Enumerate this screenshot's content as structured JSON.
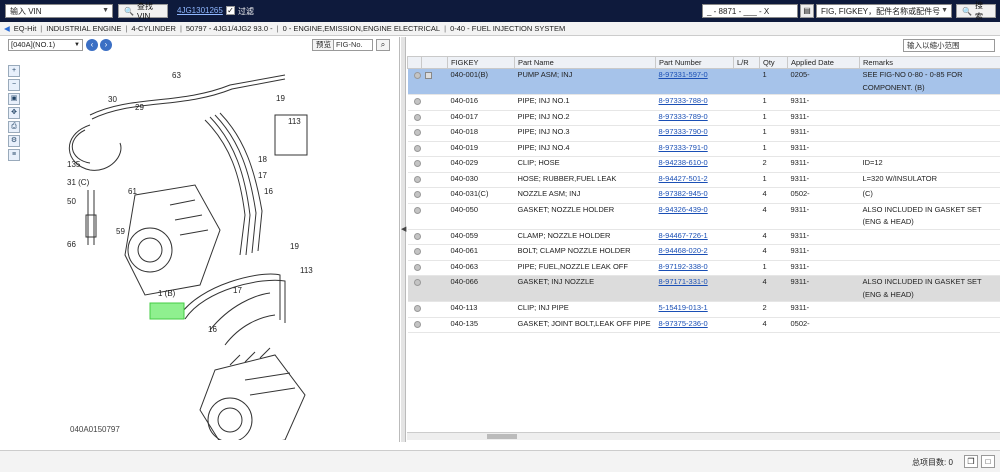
{
  "topbar": {
    "vin_select": "输入 VIN",
    "search_vin_button": "查找 VIN",
    "vin_link": "4JG1301265",
    "filter_label": "过滤",
    "code_field": "_ - 8871 - ___ - X",
    "fig_select": "FIG, FIGKEY，配件名称或配件号",
    "search_button": "搜索"
  },
  "breadcrumb": [
    "EQ-Hit",
    "INDUSTRIAL ENGINE",
    "4-CYLINDER",
    "50797 - 4JG1/4JG2 93.0 -",
    "0 - ENGINE,EMISSION,ENGINE ELECTRICAL",
    "0-40 - FUEL INJECTION SYSTEM"
  ],
  "left_toolbar": {
    "figure_select": "[040A](NO.1)",
    "preview_button": "预览",
    "fig_no_placeholder": "FIG-No."
  },
  "diagram": {
    "code": "040A0150797",
    "callouts": [
      "63",
      "30",
      "29",
      "19",
      "113",
      "18",
      "17",
      "16",
      "135",
      "31 (C)",
      "61",
      "50",
      "59",
      "66",
      "19",
      "113",
      "17",
      "16",
      "1 (B)"
    ]
  },
  "right_top": {
    "range_placeholder": "输入以缩小范围"
  },
  "table": {
    "headers": [
      "",
      "",
      "FIGKEY",
      "Part Name",
      "Part Number",
      "L/R",
      "Qty",
      "Applied Date",
      "Remarks"
    ],
    "rows": [
      {
        "figkey": "040-001(B)",
        "name": "PUMP ASM; INJ",
        "number": "8-97331-597-0",
        "lr": "",
        "qty": "1",
        "date": "0205-",
        "remarks": "SEE FIG-NO 0-80 - 0-85 FOR COMPONENT. (B)",
        "style": "selected",
        "img": true
      },
      {
        "figkey": "040-016",
        "name": "PIPE; INJ NO.1",
        "number": "8-97333-788-0",
        "lr": "",
        "qty": "1",
        "date": "9311-",
        "remarks": "",
        "style": "",
        "img": false
      },
      {
        "figkey": "040-017",
        "name": "PIPE; INJ NO.2",
        "number": "8-97333-789-0",
        "lr": "",
        "qty": "1",
        "date": "9311-",
        "remarks": "",
        "style": "",
        "img": false
      },
      {
        "figkey": "040-018",
        "name": "PIPE; INJ NO.3",
        "number": "8-97333-790-0",
        "lr": "",
        "qty": "1",
        "date": "9311-",
        "remarks": "",
        "style": "",
        "img": false
      },
      {
        "figkey": "040-019",
        "name": "PIPE; INJ NO.4",
        "number": "8-97333-791-0",
        "lr": "",
        "qty": "1",
        "date": "9311-",
        "remarks": "",
        "style": "",
        "img": false
      },
      {
        "figkey": "040-029",
        "name": "CLIP; HOSE",
        "number": "8-94238-610-0",
        "lr": "",
        "qty": "2",
        "date": "9311-",
        "remarks": "ID=12",
        "style": "",
        "img": false
      },
      {
        "figkey": "040-030",
        "name": "HOSE; RUBBER,FUEL LEAK",
        "number": "8-94427-501-2",
        "lr": "",
        "qty": "1",
        "date": "9311-",
        "remarks": "L=320 W/INSULATOR",
        "style": "",
        "img": false
      },
      {
        "figkey": "040-031(C)",
        "name": "NOZZLE ASM; INJ",
        "number": "8-97382-945-0",
        "lr": "",
        "qty": "4",
        "date": "0502-",
        "remarks": "(C)",
        "style": "",
        "img": false
      },
      {
        "figkey": "040-050",
        "name": "GASKET; NOZZLE HOLDER",
        "number": "8-94326-439-0",
        "lr": "",
        "qty": "4",
        "date": "9311-",
        "remarks": "ALSO INCLUDED IN GASKET SET (ENG & HEAD)",
        "style": "",
        "img": false
      },
      {
        "figkey": "040-059",
        "name": "CLAMP; NOZZLE HOLDER",
        "number": "8-94467-726-1",
        "lr": "",
        "qty": "4",
        "date": "9311-",
        "remarks": "",
        "style": "",
        "img": false
      },
      {
        "figkey": "040-061",
        "name": "BOLT; CLAMP NOZZLE HOLDER",
        "number": "8-94468-020-2",
        "lr": "",
        "qty": "4",
        "date": "9311-",
        "remarks": "",
        "style": "",
        "img": false
      },
      {
        "figkey": "040-063",
        "name": "PIPE; FUEL,NOZZLE LEAK OFF",
        "number": "8-97192-338-0",
        "lr": "",
        "qty": "1",
        "date": "9311-",
        "remarks": "",
        "style": "",
        "img": false
      },
      {
        "figkey": "040-066",
        "name": "GASKET; INJ NOZZLE",
        "number": "8-97171-331-0",
        "lr": "",
        "qty": "4",
        "date": "9311-",
        "remarks": "ALSO INCLUDED IN GASKET SET (ENG & HEAD)",
        "style": "gray",
        "img": false
      },
      {
        "figkey": "040-113",
        "name": "CLIP; INJ PIPE",
        "number": "5-15419-013-1",
        "lr": "",
        "qty": "2",
        "date": "9311-",
        "remarks": "",
        "style": "",
        "img": false
      },
      {
        "figkey": "040-135",
        "name": "GASKET; JOINT BOLT,LEAK OFF PIPE",
        "number": "8-97375-236-0",
        "lr": "",
        "qty": "4",
        "date": "0502-",
        "remarks": "",
        "style": "",
        "img": false
      }
    ]
  },
  "status": {
    "total_label": "总项目数:",
    "total_value": "0"
  }
}
